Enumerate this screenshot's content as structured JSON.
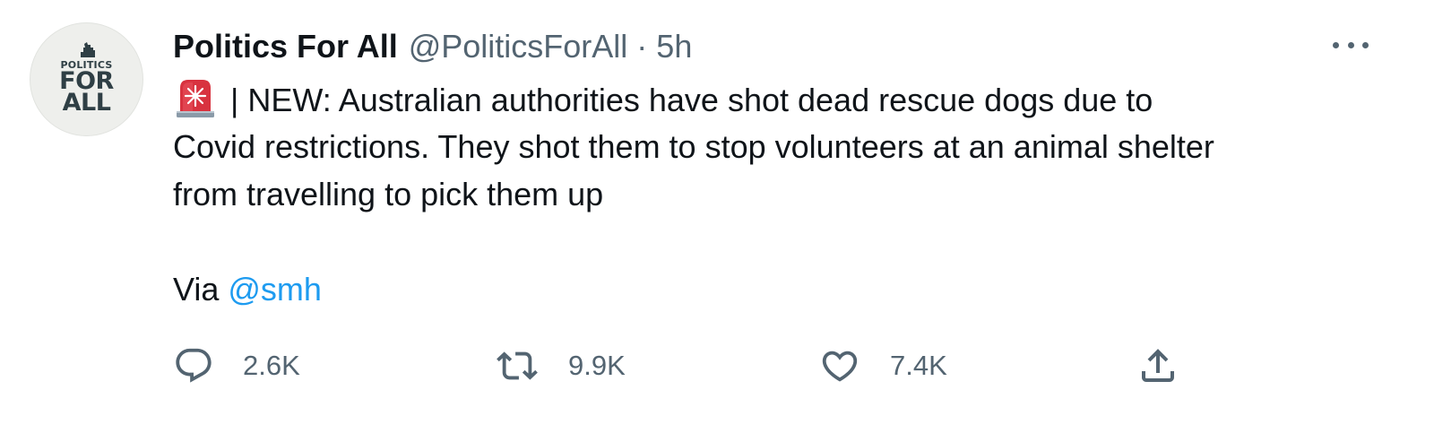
{
  "author": {
    "display_name": "Politics For All",
    "handle": "@PoliticsForAll",
    "separator": "·",
    "time": "5h",
    "avatar_text": {
      "small": "POLITICS",
      "line1": "FOR",
      "line2": "ALL"
    }
  },
  "tweet": {
    "lines": [
      "| NEW: Australian authorities have shot dead rescue dogs due to",
      "Covid restrictions. They shot them to stop volunteers at an animal shelter",
      "from travelling to pick them up"
    ],
    "via_label": "Via ",
    "mention": "@smh",
    "emoji": "police-car-light-icon"
  },
  "actions": {
    "reply_count": "2.6K",
    "retweet_count": "9.9K",
    "like_count": "7.4K"
  },
  "colors": {
    "text": "#0f1419",
    "secondary": "#536471",
    "link": "#1d9bf0"
  }
}
